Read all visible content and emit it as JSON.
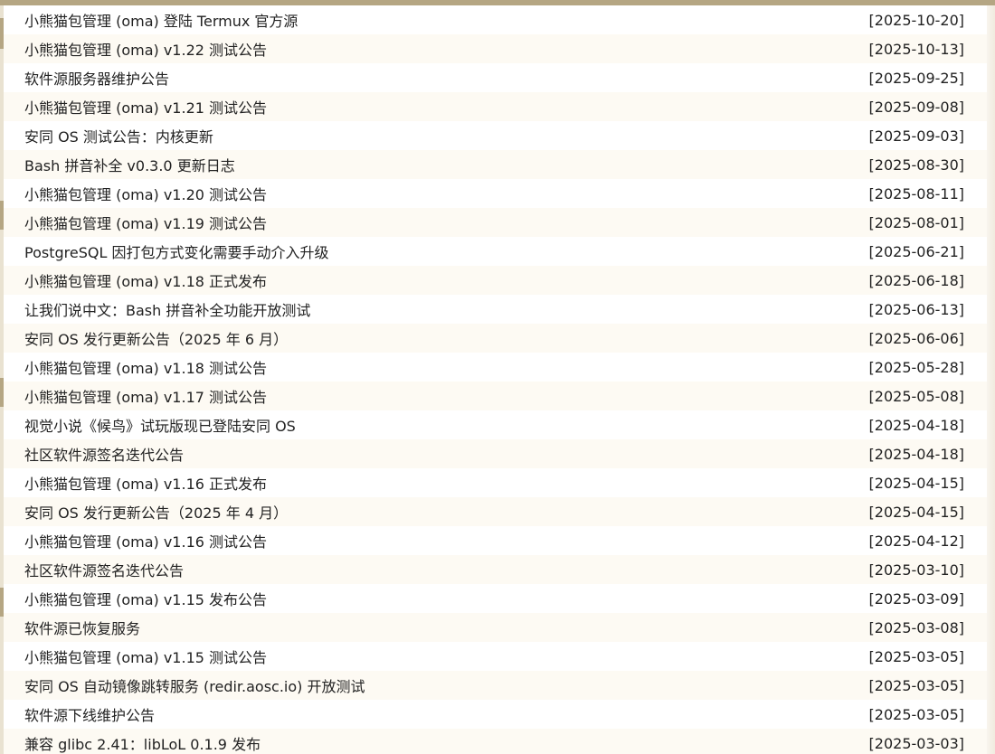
{
  "colors": {
    "accent": "#b5a683",
    "page_background": "#ffffff",
    "alt_row": "#fdfaf3",
    "text": "#222222"
  },
  "announcements": [
    {
      "title": "小熊猫包管理 (oma) 登陆 Termux 官方源",
      "date": "[2025-10-20]"
    },
    {
      "title": "小熊猫包管理 (oma) v1.22 测试公告",
      "date": "[2025-10-13]"
    },
    {
      "title": "软件源服务器维护公告",
      "date": "[2025-09-25]"
    },
    {
      "title": "小熊猫包管理 (oma) v1.21 测试公告",
      "date": "[2025-09-08]"
    },
    {
      "title": "安同 OS 测试公告：内核更新",
      "date": "[2025-09-03]"
    },
    {
      "title": "Bash 拼音补全 v0.3.0 更新日志",
      "date": "[2025-08-30]"
    },
    {
      "title": "小熊猫包管理 (oma) v1.20 测试公告",
      "date": "[2025-08-11]"
    },
    {
      "title": "小熊猫包管理 (oma) v1.19 测试公告",
      "date": "[2025-08-01]"
    },
    {
      "title": "PostgreSQL 因打包方式变化需要手动介入升级",
      "date": "[2025-06-21]"
    },
    {
      "title": "小熊猫包管理 (oma) v1.18 正式发布",
      "date": "[2025-06-18]"
    },
    {
      "title": "让我们说中文：Bash 拼音补全功能开放测试",
      "date": "[2025-06-13]"
    },
    {
      "title": "安同 OS 发行更新公告（2025 年 6 月）",
      "date": "[2025-06-06]"
    },
    {
      "title": "小熊猫包管理 (oma) v1.18 测试公告",
      "date": "[2025-05-28]"
    },
    {
      "title": "小熊猫包管理 (oma) v1.17 测试公告",
      "date": "[2025-05-08]"
    },
    {
      "title": "视觉小说《候鸟》试玩版现已登陆安同 OS",
      "date": "[2025-04-18]"
    },
    {
      "title": "社区软件源签名迭代公告",
      "date": "[2025-04-18]"
    },
    {
      "title": "小熊猫包管理 (oma) v1.16 正式发布",
      "date": "[2025-04-15]"
    },
    {
      "title": "安同 OS 发行更新公告（2025 年 4 月）",
      "date": "[2025-04-15]"
    },
    {
      "title": "小熊猫包管理 (oma) v1.16 测试公告",
      "date": "[2025-04-12]"
    },
    {
      "title": "社区软件源签名迭代公告",
      "date": "[2025-03-10]"
    },
    {
      "title": "小熊猫包管理 (oma) v1.15 发布公告",
      "date": "[2025-03-09]"
    },
    {
      "title": "软件源已恢复服务",
      "date": "[2025-03-08]"
    },
    {
      "title": "小熊猫包管理 (oma) v1.15 测试公告",
      "date": "[2025-03-05]"
    },
    {
      "title": "安同 OS 自动镜像跳转服务 (redir.aosc.io) 开放测试",
      "date": "[2025-03-05]"
    },
    {
      "title": "软件源下线维护公告",
      "date": "[2025-03-05]"
    },
    {
      "title": "兼容 glibc 2.41：libLoL 0.1.9 发布",
      "date": "[2025-03-03]"
    }
  ]
}
